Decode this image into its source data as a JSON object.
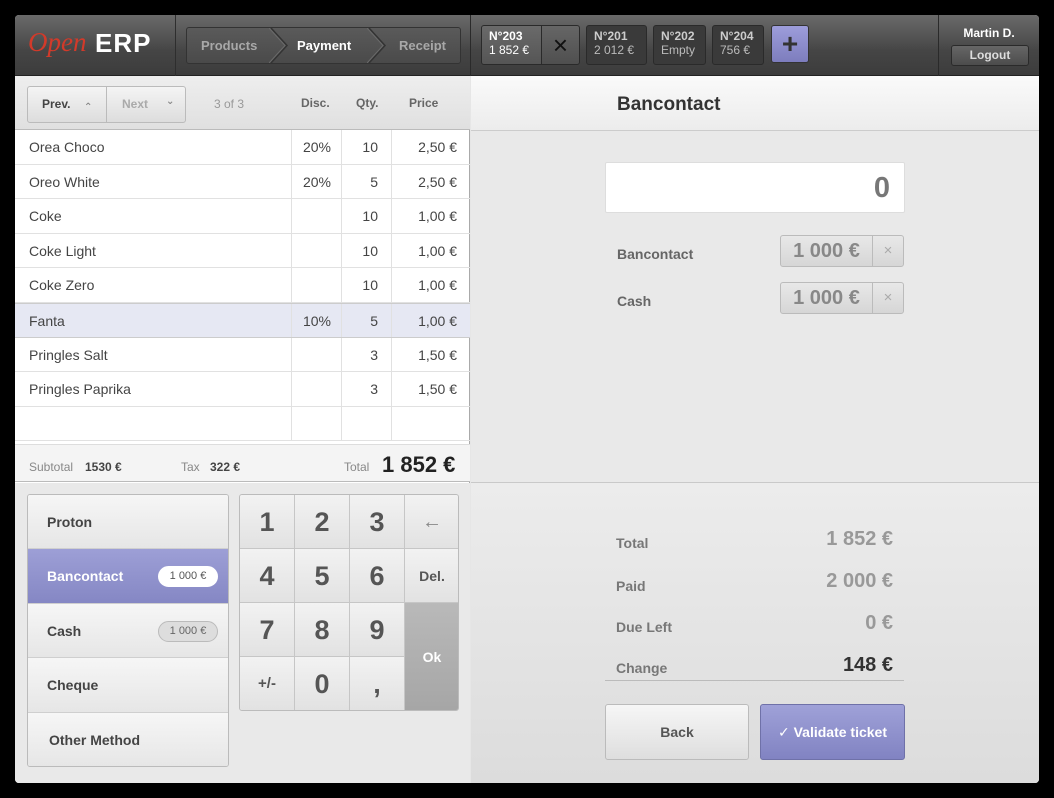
{
  "brand": {
    "open": "Open",
    "erp": "ERP"
  },
  "steps": [
    "Products",
    "Payment",
    "Receipt"
  ],
  "tickets": [
    {
      "num": "N°203",
      "sub": "1 852 €"
    },
    {
      "num": "N°201",
      "sub": "2 012 €"
    },
    {
      "num": "N°202",
      "sub": "Empty"
    },
    {
      "num": "N°204",
      "sub": "756 €"
    }
  ],
  "icons": {
    "close": "×",
    "plus": "+",
    "back_arrow": "←",
    "remove": "×",
    "check": "✓",
    "chevron_up": "⌃",
    "chevron_down": "⌄"
  },
  "user": {
    "name": "Martin D.",
    "logout": "Logout"
  },
  "pager": {
    "prev": "Prev.",
    "next": "Next",
    "pages": "3 of 3"
  },
  "columns": {
    "disc": "Disc.",
    "qty": "Qty.",
    "price": "Price"
  },
  "order_lines": [
    {
      "name": "Orea Choco",
      "disc": "20%",
      "qty": "10",
      "price": "2,50 €"
    },
    {
      "name": "Oreo White",
      "disc": "20%",
      "qty": "5",
      "price": "2,50 €"
    },
    {
      "name": "Coke",
      "disc": "",
      "qty": "10",
      "price": "1,00 €"
    },
    {
      "name": "Coke Light",
      "disc": "",
      "qty": "10",
      "price": "1,00 €"
    },
    {
      "name": "Coke Zero",
      "disc": "",
      "qty": "10",
      "price": "1,00 €"
    },
    {
      "name": "Fanta",
      "disc": "10%",
      "qty": "5",
      "price": "1,00 €"
    },
    {
      "name": "Pringles Salt",
      "disc": "",
      "qty": "3",
      "price": "1,50 €"
    },
    {
      "name": "Pringles Paprika",
      "disc": "",
      "qty": "3",
      "price": "1,50 €"
    },
    {
      "name": "",
      "disc": "",
      "qty": "",
      "price": ""
    }
  ],
  "totals": {
    "subtotal_label": "Subtotal",
    "subtotal": "1530 €",
    "tax_label": "Tax",
    "tax": "322 €",
    "total_label": "Total",
    "total": "1 852 €"
  },
  "methods": [
    {
      "label": "Proton",
      "badge": ""
    },
    {
      "label": "Bancontact",
      "badge": "1 000 €"
    },
    {
      "label": "Cash",
      "badge": "1 000 €"
    },
    {
      "label": "Cheque",
      "badge": ""
    },
    {
      "label": "Other Method",
      "badge": ""
    }
  ],
  "keypad": {
    "k1": "1",
    "k2": "2",
    "k3": "3",
    "k4": "4",
    "k5": "5",
    "k6": "6",
    "k7": "7",
    "k8": "8",
    "k9": "9",
    "k0": "0",
    "sign": "+/-",
    "comma": ",",
    "del": "Del.",
    "ok": "Ok"
  },
  "payment": {
    "title": "Bancontact",
    "amount": "0",
    "lines": [
      {
        "label": "Bancontact",
        "value": "1 000 €"
      },
      {
        "label": "Cash",
        "value": "1 000 €"
      }
    ]
  },
  "summary": {
    "total_label": "Total",
    "total": "1 852 €",
    "paid_label": "Paid",
    "paid": "2 000 €",
    "due_label": "Due Left",
    "due": "0 €",
    "change_label": "Change",
    "change": "148 €"
  },
  "actions": {
    "back": "Back",
    "validate": "Validate ticket"
  }
}
